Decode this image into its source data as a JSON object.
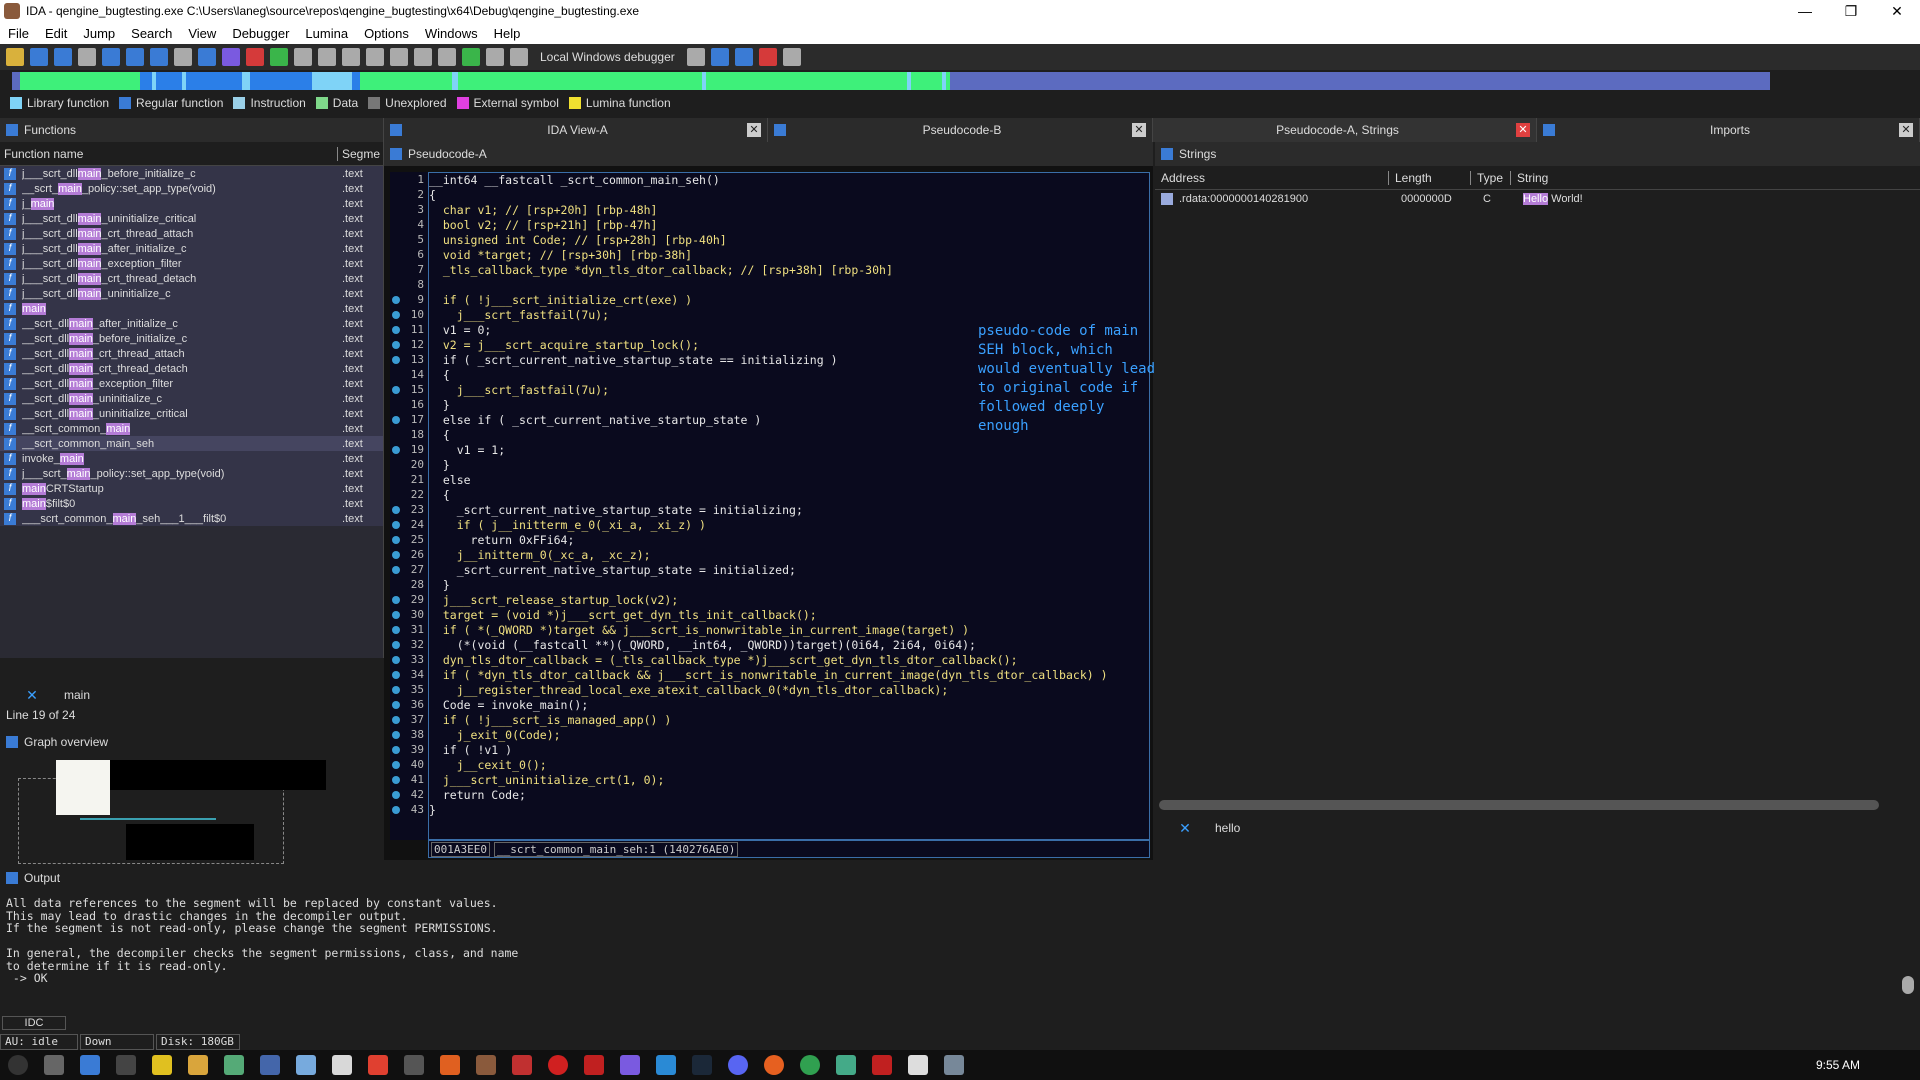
{
  "window": {
    "title": "IDA - qengine_bugtesting.exe C:\\Users\\laneg\\source\\repos\\qengine_bugtesting\\x64\\Debug\\qengine_bugtesting.exe"
  },
  "menu": [
    "File",
    "Edit",
    "Jump",
    "Search",
    "View",
    "Debugger",
    "Lumina",
    "Options",
    "Windows",
    "Help"
  ],
  "toolbar": {
    "debugger_label": "Local Windows debugger"
  },
  "legend": [
    {
      "label": "Library function",
      "color": "#7fd3f7"
    },
    {
      "label": "Regular function",
      "color": "#3a7bd5"
    },
    {
      "label": "Instruction",
      "color": "#9ad0e8"
    },
    {
      "label": "Data",
      "color": "#7fd88a"
    },
    {
      "label": "Unexplored",
      "color": "#777777"
    },
    {
      "label": "External symbol",
      "color": "#e040e0"
    },
    {
      "label": "Lumina function",
      "color": "#f0e030"
    }
  ],
  "functions": {
    "title": "Functions",
    "col_name": "Function name",
    "col_segment": "Segme",
    "rows": [
      {
        "pre": "j___scrt_dll",
        "hl": "main",
        "post": "_before_initialize_c",
        "seg": ".text"
      },
      {
        "pre": "__scrt_",
        "hl": "main",
        "post": "_policy::set_app_type(void)",
        "seg": ".text"
      },
      {
        "pre": "j_",
        "hl": "main",
        "post": "",
        "seg": ".text"
      },
      {
        "pre": "j___scrt_dll",
        "hl": "main",
        "post": "_uninitialize_critical",
        "seg": ".text"
      },
      {
        "pre": "j___scrt_dll",
        "hl": "main",
        "post": "_crt_thread_attach",
        "seg": ".text"
      },
      {
        "pre": "j___scrt_dll",
        "hl": "main",
        "post": "_after_initialize_c",
        "seg": ".text"
      },
      {
        "pre": "j___scrt_dll",
        "hl": "main",
        "post": "_exception_filter",
        "seg": ".text"
      },
      {
        "pre": "j___scrt_dll",
        "hl": "main",
        "post": "_crt_thread_detach",
        "seg": ".text"
      },
      {
        "pre": "j___scrt_dll",
        "hl": "main",
        "post": "_uninitialize_c",
        "seg": ".text"
      },
      {
        "pre": "",
        "hl": "main",
        "post": "",
        "seg": ".text"
      },
      {
        "pre": "__scrt_dll",
        "hl": "main",
        "post": "_after_initialize_c",
        "seg": ".text"
      },
      {
        "pre": "__scrt_dll",
        "hl": "main",
        "post": "_before_initialize_c",
        "seg": ".text"
      },
      {
        "pre": "__scrt_dll",
        "hl": "main",
        "post": "_crt_thread_attach",
        "seg": ".text"
      },
      {
        "pre": "__scrt_dll",
        "hl": "main",
        "post": "_crt_thread_detach",
        "seg": ".text"
      },
      {
        "pre": "__scrt_dll",
        "hl": "main",
        "post": "_exception_filter",
        "seg": ".text"
      },
      {
        "pre": "__scrt_dll",
        "hl": "main",
        "post": "_uninitialize_c",
        "seg": ".text"
      },
      {
        "pre": "__scrt_dll",
        "hl": "main",
        "post": "_uninitialize_critical",
        "seg": ".text"
      },
      {
        "pre": "__scrt_common_",
        "hl": "main",
        "post": "",
        "seg": ".text"
      },
      {
        "pre": "__scrt_common_main_seh",
        "hl": "",
        "post": "",
        "seg": ".text"
      },
      {
        "pre": "invoke_",
        "hl": "main",
        "post": "",
        "seg": ".text"
      },
      {
        "pre": "j___scrt_",
        "hl": "main",
        "post": "_policy::set_app_type(void)",
        "seg": ".text"
      },
      {
        "pre": "",
        "hl": "main",
        "post": "CRTStartup",
        "seg": ".text"
      },
      {
        "pre": "",
        "hl": "main",
        "post": "$filt$0",
        "seg": ".text"
      },
      {
        "pre": "___scrt_common_",
        "hl": "main",
        "post": "_seh___1___filt$0",
        "seg": ".text"
      }
    ],
    "search_value": "main",
    "line_info": "Line 19 of 24"
  },
  "graph_overview": {
    "title": "Graph overview"
  },
  "tabs": [
    {
      "label": "IDA View-A"
    },
    {
      "label": "Pseudocode-B"
    },
    {
      "label": "Pseudocode-A, Strings"
    },
    {
      "label": "Imports"
    }
  ],
  "pseudocode": {
    "title": "Pseudocode-A",
    "lines": [
      "__int64 __fastcall _scrt_common_main_seh()",
      "{",
      "  char v1; // [rsp+20h] [rbp-48h]",
      "  bool v2; // [rsp+21h] [rbp-47h]",
      "  unsigned int Code; // [rsp+28h] [rbp-40h]",
      "  void *target; // [rsp+30h] [rbp-38h]",
      "  _tls_callback_type *dyn_tls_dtor_callback; // [rsp+38h] [rbp-30h]",
      "",
      "  if ( !j___scrt_initialize_crt(exe) )",
      "    j___scrt_fastfail(7u);",
      "  v1 = 0;",
      "  v2 = j___scrt_acquire_startup_lock();",
      "  if ( _scrt_current_native_startup_state == initializing )",
      "  {",
      "    j___scrt_fastfail(7u);",
      "  }",
      "  else if ( _scrt_current_native_startup_state )",
      "  {",
      "    v1 = 1;",
      "  }",
      "  else",
      "  {",
      "    _scrt_current_native_startup_state = initializing;",
      "    if ( j__initterm_e_0(_xi_a, _xi_z) )",
      "      return 0xFFi64;",
      "    j__initterm_0(_xc_a, _xc_z);",
      "    _scrt_current_native_startup_state = initialized;",
      "  }",
      "  j___scrt_release_startup_lock(v2);",
      "  target = (void *)j___scrt_get_dyn_tls_init_callback();",
      "  if ( *(_QWORD *)target && j___scrt_is_nonwritable_in_current_image(target) )",
      "    (*(void (__fastcall **)(_QWORD, __int64, _QWORD))target)(0i64, 2i64, 0i64);",
      "  dyn_tls_dtor_callback = (_tls_callback_type *)j___scrt_get_dyn_tls_dtor_callback();",
      "  if ( *dyn_tls_dtor_callback && j___scrt_is_nonwritable_in_current_image(dyn_tls_dtor_callback) )",
      "    j__register_thread_local_exe_atexit_callback_0(*dyn_tls_dtor_callback);",
      "  Code = invoke_main();",
      "  if ( !j___scrt_is_managed_app() )",
      "    j_exit_0(Code);",
      "  if ( !v1 )",
      "    j__cexit_0();",
      "  j___scrt_uninitialize_crt(1, 0);",
      "  return Code;",
      "}"
    ],
    "breakpoints": [
      9,
      10,
      11,
      12,
      13,
      15,
      17,
      19,
      23,
      24,
      25,
      26,
      27,
      29,
      30,
      31,
      32,
      33,
      34,
      35,
      36,
      37,
      38,
      39,
      40,
      41,
      42,
      43
    ],
    "annotation": "pseudo-code of main SEH block, which would eventually lead to original code if followed deeply enough",
    "status_addr": "001A3EE0",
    "status_func": "__scrt_common_main_seh:1 (140276AE0)"
  },
  "strings": {
    "title": "Strings",
    "columns": [
      "Address",
      "Length",
      "Type",
      "String"
    ],
    "rows": [
      {
        "address": ".rdata:0000000140281900",
        "length": "0000000D",
        "type": "C",
        "hl": "Hello",
        "rest": " World!"
      }
    ],
    "search_value": "hello"
  },
  "output": {
    "title": "Output",
    "lines": [
      "All data references to the segment will be replaced by constant values.",
      "This may lead to drastic changes in the decompiler output.",
      "If the segment is not read-only, please change the segment PERMISSIONS.",
      "",
      "In general, the decompiler checks the segment permissions, class, and name",
      "to determine if it is read-only.",
      " -> OK"
    ]
  },
  "idc_label": "IDC",
  "status": {
    "au": "AU:  idle",
    "dir": "Down",
    "disk": "Disk: 180GB"
  },
  "taskbar": {
    "time": "9:55 AM"
  }
}
